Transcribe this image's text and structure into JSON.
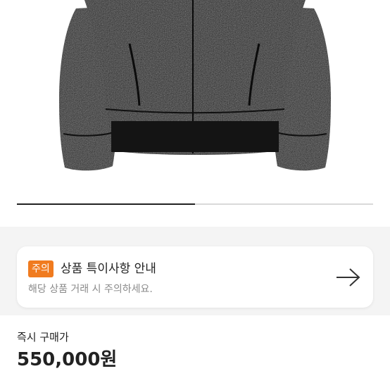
{
  "gallery": {
    "progress_fraction": 0.5
  },
  "notice": {
    "badge": "주의",
    "title": "상품 특이사항 안내",
    "subtitle": "해당 상품 거래 시 주의하세요.",
    "arrow_icon": "arrow-right-icon",
    "badge_color": "#f07b1f"
  },
  "price": {
    "label": "즉시 구매가",
    "value": "550,000원"
  }
}
